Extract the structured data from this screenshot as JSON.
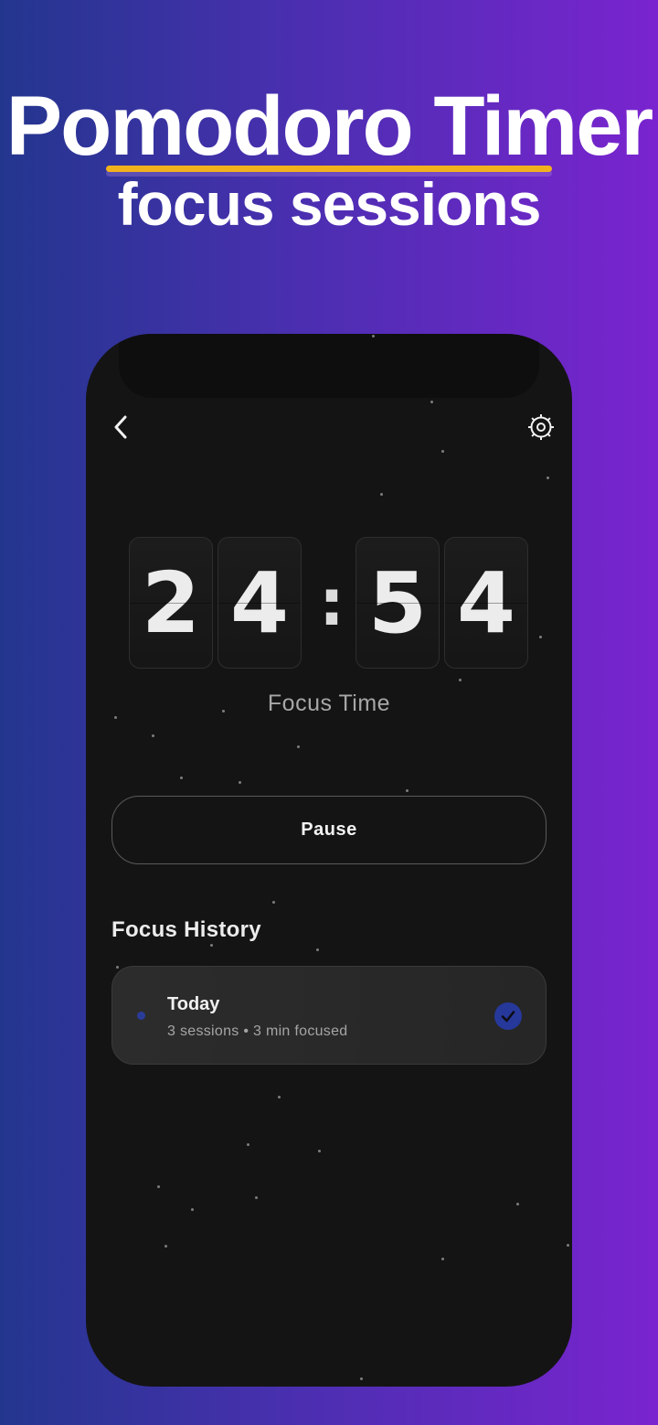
{
  "headline": {
    "title": "Pomodoro Timer",
    "subtitle": "focus sessions"
  },
  "topbar": {
    "back_icon": "chevron-left-icon",
    "settings_icon": "gear-icon"
  },
  "timer": {
    "digits": [
      "2",
      "4",
      "5",
      "4"
    ],
    "separator": ":",
    "mode_label": "Focus Time"
  },
  "controls": {
    "pause_label": "Pause"
  },
  "history": {
    "title": "Focus History",
    "items": [
      {
        "day": "Today",
        "sessions": "3 sessions",
        "separator": "•",
        "focused": "3 min focused",
        "completed": true
      }
    ]
  },
  "colors": {
    "background_start": "#23368e",
    "background_end": "#7a24cf",
    "accent_underline": "#f2b21c",
    "phone_bg": "#141414",
    "check_badge": "#26389a"
  }
}
